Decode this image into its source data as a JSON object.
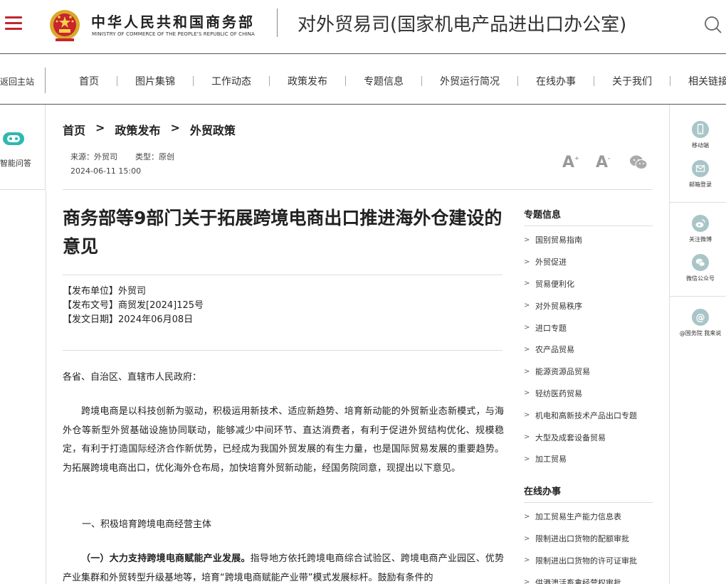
{
  "header": {
    "ministry_cn": "中华人民共和国商务部",
    "ministry_en": "MINISTRY OF COMMERCE OF THE PEOPLE'S REPUBLIC OF CHINA",
    "dept_title": "对外贸易司(国家机电产品进出口办公室)",
    "menu_icon": "hamburger-menu-icon",
    "search_icon": "search-icon"
  },
  "nav": {
    "back_home": "返回主站",
    "items": [
      "首页",
      "图片集锦",
      "工作动态",
      "政策发布",
      "专题信息",
      "外贸运行简况",
      "在线办事",
      "关于我们",
      "相关链接"
    ]
  },
  "left_panel": {
    "ai_label": "智能问答",
    "icon": "robot-icon"
  },
  "breadcrumb": [
    "首页",
    "政策发布",
    "外贸政策"
  ],
  "breadcrumb_sep": ">",
  "meta": {
    "source": "来源：外贸司",
    "type": "类型：原创",
    "date": "2024-06-11 15:00",
    "font_large": "A",
    "font_small": "A"
  },
  "article": {
    "title": "商务部等9部门关于拓展跨境电商出口推进海外仓建设的意见",
    "issuer": "【发布单位】外贸司",
    "doc_no": "【发布文号】商贸发[2024]125号",
    "issue_date": "【发文日期】2024年06月08日",
    "salutation": "各省、自治区、直辖市人民政府：",
    "para1": "跨境电商是以科技创新为驱动，积极运用新技术、适应新趋势、培育新动能的外贸新业态新模式，与海外仓等新型外贸基础设施协同联动，能够减少中间环节、直达消费者，有利于促进外贸结构优化、规模稳定，有利于打造国际经济合作新优势，已经成为我国外贸发展的有生力量，也是国际贸易发展的重要趋势。为拓展跨境电商出口，优化海外仓布局，加快培育外贸新动能，经国务院同意，现提出以下意见。",
    "section1": "一、积极培育跨境电商经营主体",
    "para2_bold": "（一）大力支持跨境电商赋能产业发展。",
    "para2_rest": "指导地方依托跨境电商综合试验区、跨境电商产业园区、优势产业集群和外贸转型升级基地等，培育“跨境电商赋能产业带”模式发展标杆。鼓励有条件的"
  },
  "sidebar": {
    "topics_heading": "专题信息",
    "topics": [
      "国别贸易指南",
      "外贸促进",
      "贸易便利化",
      "对外贸易秩序",
      "进口专题",
      "农产品贸易",
      "能源资源品贸易",
      "轻纺医药贸易",
      "机电和高新技术产品出口专题",
      "大型及成套设备贸易",
      "加工贸易"
    ],
    "online_heading": "在线办事",
    "online": [
      "加工贸易生产能力信息表",
      "限制进出口货物的配额审批",
      "限制进出口货物的许可证审批",
      "供港澳活畜禽经营权审批"
    ]
  },
  "right_float": {
    "items": [
      {
        "label": "移动端",
        "icon": "mobile-icon"
      },
      {
        "label": "邮箱登录",
        "icon": "mail-icon"
      },
      {
        "label": "关注微博",
        "icon": "weibo-icon"
      },
      {
        "label": "微信公众号",
        "icon": "wechat-icon"
      },
      {
        "label": "@国务院 我来说",
        "icon": "at-icon"
      }
    ]
  },
  "colors": {
    "brand_red": "#c0262d",
    "icon_teal": "#a9c5c8",
    "robot_teal": "#2fb8b0"
  }
}
